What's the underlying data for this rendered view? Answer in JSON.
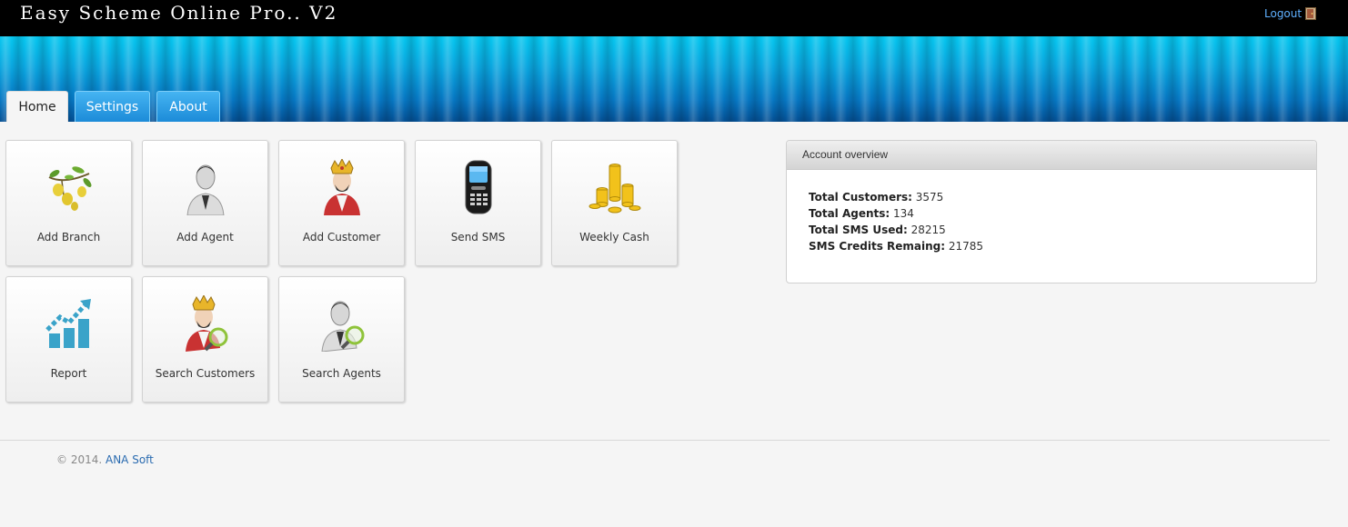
{
  "app": {
    "title": "Easy Scheme Online Pro.. V2"
  },
  "header": {
    "logout_label": "Logout",
    "logout_icon": "door-icon"
  },
  "tabs": [
    {
      "label": "Home",
      "active": true
    },
    {
      "label": "Settings",
      "active": false
    },
    {
      "label": "About",
      "active": false
    }
  ],
  "tiles": [
    {
      "label": "Add Branch",
      "icon": "lemon-branch-icon"
    },
    {
      "label": "Add Agent",
      "icon": "agent-person-icon"
    },
    {
      "label": "Add Customer",
      "icon": "king-customer-icon"
    },
    {
      "label": "Send SMS",
      "icon": "mobile-phone-icon"
    },
    {
      "label": "Weekly Cash",
      "icon": "gold-coins-icon"
    },
    {
      "label": "Report",
      "icon": "bar-chart-growth-icon"
    },
    {
      "label": "Search Customers",
      "icon": "king-magnifier-icon"
    },
    {
      "label": "Search Agents",
      "icon": "agent-magnifier-icon"
    }
  ],
  "account_overview": {
    "title": "Account overview",
    "stats": [
      {
        "label": "Total Customers:",
        "value": "3575"
      },
      {
        "label": "Total Agents:",
        "value": "134"
      },
      {
        "label": "Total SMS Used:",
        "value": "28215"
      },
      {
        "label": "SMS Credits Remaing:",
        "value": "21785"
      }
    ]
  },
  "footer": {
    "copyright": "© 2014.",
    "company": "ANA Soft"
  },
  "colors": {
    "topbar": "#000000",
    "banner_light": "#06c7ef",
    "banner_dark": "#044f93",
    "tab_blue": "#2a9be3",
    "link": "#2a6bb0"
  }
}
